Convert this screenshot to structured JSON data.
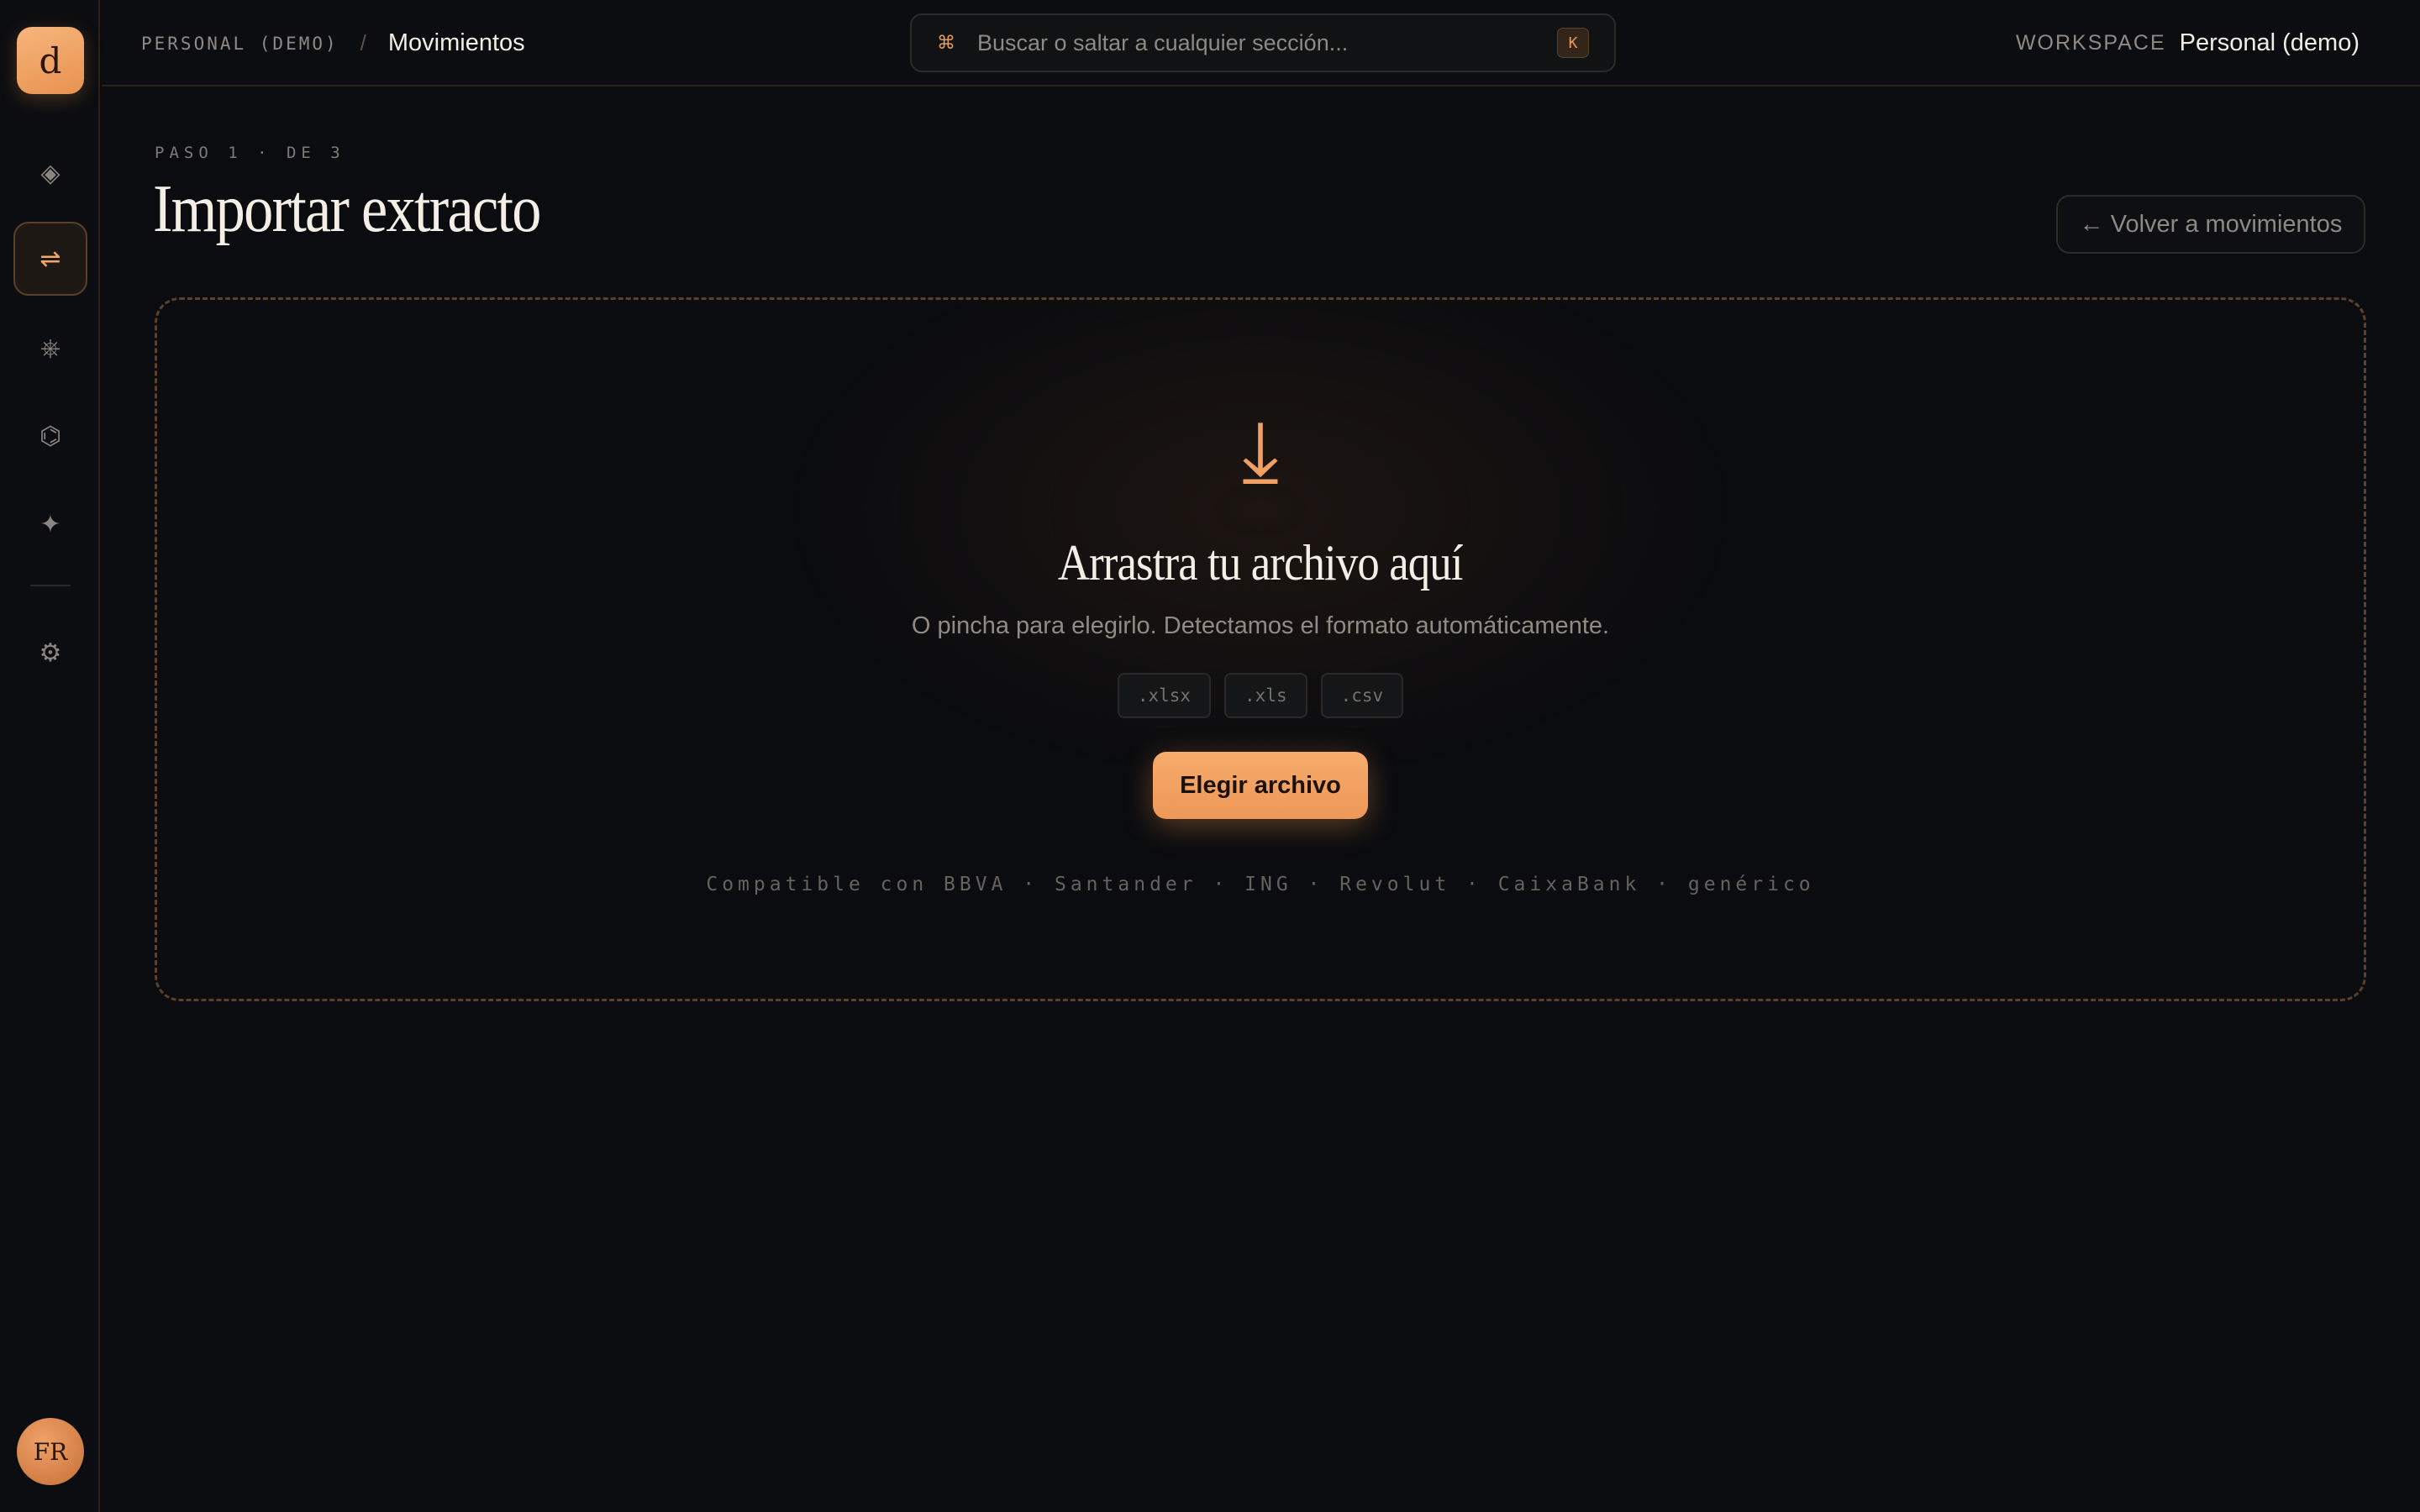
{
  "sidebar": {
    "logo": "d",
    "items": [
      {
        "name": "dashboard",
        "icon": "◈"
      },
      {
        "name": "movimientos",
        "icon": "⇌",
        "active": true
      },
      {
        "name": "categorias",
        "icon": "⎈"
      },
      {
        "name": "cuentas",
        "icon": "⌬"
      },
      {
        "name": "insights",
        "icon": "✦"
      }
    ],
    "settings_icon": "⚙",
    "avatar": "FR"
  },
  "topbar": {
    "breadcrumb": {
      "workspace": "PERSONAL (DEMO)",
      "separator": "/",
      "current": "Movimientos"
    },
    "search": {
      "cmd_icon": "⌘",
      "placeholder": "Buscar o saltar a cualquier sección...",
      "shortcut": "K"
    },
    "workspace": {
      "label": "WORKSPACE",
      "name": "Personal (demo)"
    }
  },
  "page": {
    "step": "PASO 1 · DE 3",
    "title": "Importar extracto",
    "back_label": "← Volver a movimientos"
  },
  "dropzone": {
    "icon": "⤓",
    "title": "Arrastra tu archivo aquí",
    "subtitle": "O pincha para elegirlo. Detectamos el formato automáticamente.",
    "formats": [
      ".xlsx",
      ".xls",
      ".csv"
    ],
    "button": "Elegir archivo",
    "compat": "Compatible con BBVA · Santander · ING · Revolut · CaixaBank · genérico"
  },
  "colors": {
    "accent": "#f0a062",
    "background": "#0b0c0f",
    "border": "#5c4128"
  }
}
